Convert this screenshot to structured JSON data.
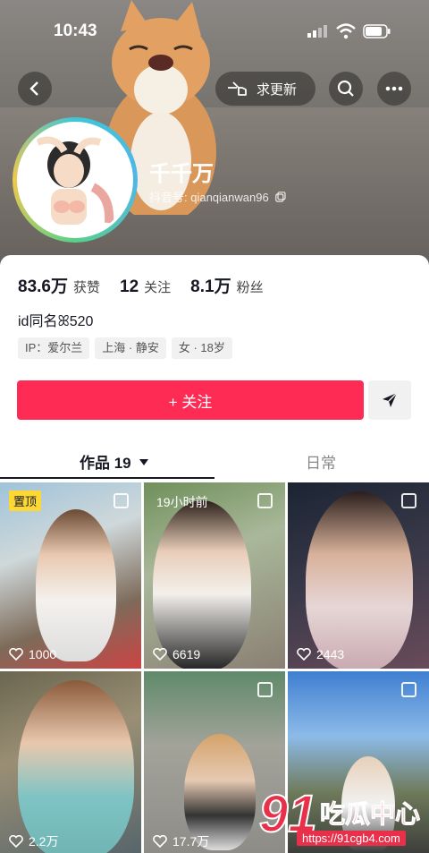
{
  "status_bar": {
    "time": "10:43"
  },
  "header": {
    "request_update_label": "求更新"
  },
  "profile": {
    "name": "千千万",
    "douyin_id": "抖音号: qianqianwan96",
    "likes_count": "83.6万",
    "likes_label": "获赞",
    "following_count": "12",
    "following_label": "关注",
    "followers_count": "8.1万",
    "followers_label": "粉丝",
    "bio": "id同名ꕤ520",
    "tags": [
      "IP：爱尔兰",
      "上海 · 静安",
      "女 · 18岁"
    ],
    "follow_label": "+ 关注"
  },
  "tabs": {
    "works_label": "作品 19",
    "daily_label": "日常"
  },
  "videos": [
    {
      "badge": "置顶",
      "likes": "1000"
    },
    {
      "badge": "19小时前",
      "likes": "6619"
    },
    {
      "badge": "",
      "likes": "2443"
    },
    {
      "badge": "",
      "likes": "2.2万"
    },
    {
      "badge": "",
      "likes": "17.7万"
    },
    {
      "badge": "",
      "likes": ""
    }
  ],
  "watermark": {
    "num": "91",
    "text": "吃瓜中心",
    "url": "https://91cgb4.com"
  },
  "colors": {
    "accent": "#fe2c55",
    "pinned": "#fdd835"
  },
  "icons": [
    "back-arrow-icon",
    "hand-pointer-icon",
    "search-icon",
    "more-icon",
    "copy-icon",
    "send-icon",
    "heart-icon",
    "dropdown-triangle-icon"
  ]
}
